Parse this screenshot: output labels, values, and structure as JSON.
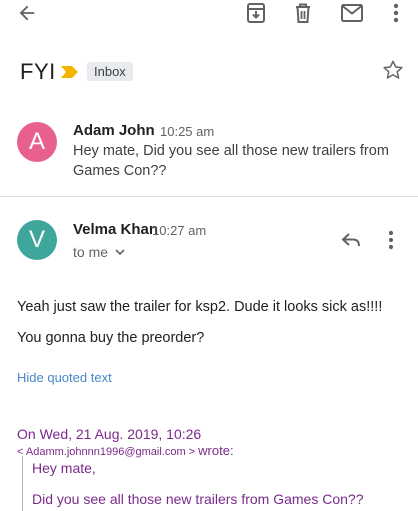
{
  "toolbar": {
    "back_icon": "arrow-back-icon",
    "archive_icon": "archive-icon",
    "delete_icon": "trash-icon",
    "mail_icon": "mail-icon",
    "more_icon": "more-vert-icon"
  },
  "thread": {
    "subject": "FYI",
    "label": "Inbox",
    "importance_color": "#f4b400"
  },
  "messages": [
    {
      "avatar_letter": "A",
      "avatar_color": "#e8608f",
      "sender": "Adam John",
      "time": "10:25 am",
      "snippet": "Hey mate, Did you see all those new trailers from Games Con??"
    },
    {
      "avatar_letter": "V",
      "avatar_color": "#3ea69a",
      "sender": "Velma Khan",
      "time": "10:27 am",
      "recipient": "to me",
      "body": [
        "Yeah just saw the trailer for ksp2. Dude it looks sick as!!!!",
        "You gonna buy the preorder?"
      ],
      "hide_quoted": "Hide quoted text",
      "quote": {
        "header": "On Wed, 21 Aug. 2019, 10:26",
        "email": "< Adamm.johnnn1996@gmail.com >",
        "wrote": "wrote:",
        "lines": [
          "Hey mate,",
          "Did you see all those new trailers from Games Con??"
        ]
      }
    }
  ],
  "colors": {
    "quote": "#7a2b8a",
    "link": "#4a88c7"
  }
}
